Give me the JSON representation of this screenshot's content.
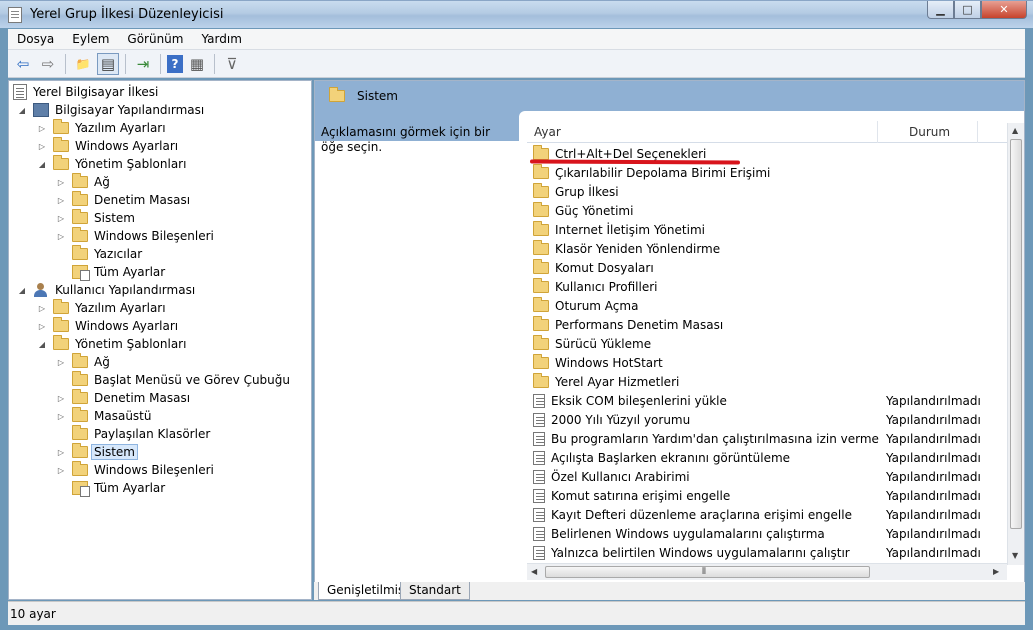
{
  "window": {
    "title": "Yerel Grup İlkesi Düzenleyicisi",
    "min": "▁",
    "max": "□",
    "close": "✕"
  },
  "menu": [
    "Dosya",
    "Eylem",
    "Görünüm",
    "Yardım"
  ],
  "toolbar": {
    "icons": [
      "back-icon",
      "forward-icon",
      "up-folder-icon",
      "show-hide-tree-icon",
      "export-list-icon",
      "help-icon",
      "properties-icon",
      "filter-icon"
    ],
    "glyphs": [
      "⇦",
      "⇨",
      "📁",
      "▤",
      "⇥",
      "?",
      "▦",
      "⊽"
    ]
  },
  "tree": {
    "root": "Yerel Bilgisayar İlkesi",
    "computer": "Bilgisayar Yapılandırması",
    "user": "Kullanıcı Yapılandırması",
    "items": [
      "Yazılım Ayarları",
      "Windows Ayarları",
      "Yönetim Şablonları",
      "Ağ",
      "Denetim Masası",
      "Sistem",
      "Windows Bileşenleri",
      "Yazıcılar",
      "Tüm Ayarlar",
      "Yazılım Ayarları",
      "Windows Ayarları",
      "Yönetim Şablonları",
      "Ağ",
      "Başlat Menüsü ve Görev Çubuğu",
      "Denetim Masası",
      "Masaüstü",
      "Paylaşılan Klasörler",
      "Sistem",
      "Windows Bileşenleri",
      "Tüm Ayarlar"
    ]
  },
  "right": {
    "header": "Sistem",
    "description": "Açıklamasını görmek için bir öğe seçin.",
    "columns": {
      "setting": "Ayar",
      "state": "Durum"
    },
    "folders": [
      "Ctrl+Alt+Del Seçenekleri",
      "Çıkarılabilir Depolama Birimi Erişimi",
      "Grup İlkesi",
      "Güç Yönetimi",
      "Internet İletişim Yönetimi",
      "Klasör Yeniden Yönlendirme",
      "Komut Dosyaları",
      "Kullanıcı Profilleri",
      "Oturum Açma",
      "Performans Denetim Masası",
      "Sürücü Yükleme",
      "Windows HotStart",
      "Yerel Ayar Hizmetleri"
    ],
    "policies": [
      {
        "name": "Eksik COM bileşenlerini yükle",
        "state": "Yapılandırılmadı"
      },
      {
        "name": "2000 Yılı Yüzyıl yorumu",
        "state": "Yapılandırılmadı"
      },
      {
        "name": "Bu programların Yardım'dan çalıştırılmasına izin verme",
        "state": "Yapılandırılmadı"
      },
      {
        "name": "Açılışta Başlarken ekranını görüntüleme",
        "state": "Yapılandırılmadı"
      },
      {
        "name": "Özel Kullanıcı Arabirimi",
        "state": "Yapılandırılmadı"
      },
      {
        "name": "Komut satırına erişimi engelle",
        "state": "Yapılandırılmadı"
      },
      {
        "name": "Kayıt Defteri düzenleme araçlarına erişimi engelle",
        "state": "Yapılandırılmadı"
      },
      {
        "name": "Belirlenen Windows uygulamalarını çalıştırma",
        "state": "Yapılandırılmadı"
      },
      {
        "name": "Yalnızca belirtilen Windows uygulamalarını çalıştır",
        "state": "Yapılandırılmadı"
      }
    ],
    "tabs": [
      "Genişletilmiş",
      "Standart"
    ],
    "scroll": {
      "up": "▲",
      "down": "▼",
      "left": "◀",
      "right": "▶",
      "grip": "⦀"
    }
  },
  "status": "10 ayar",
  "colors": {
    "highlight": "#d8141c",
    "header": "#8fb0d3"
  }
}
